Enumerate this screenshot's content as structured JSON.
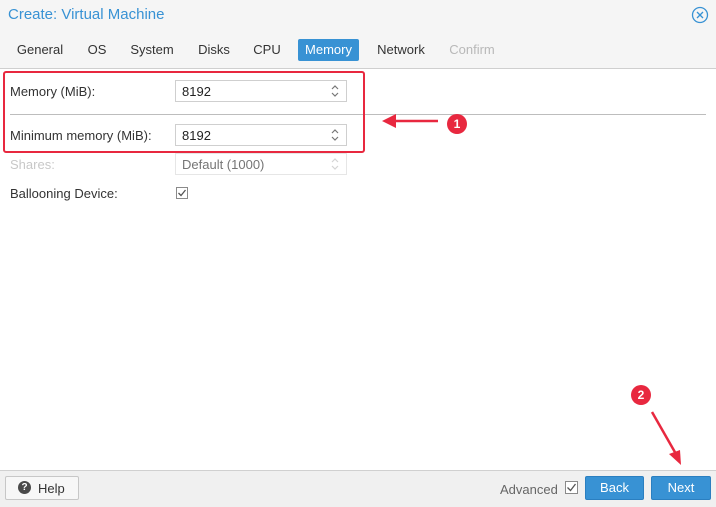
{
  "window": {
    "title": "Create: Virtual Machine",
    "close_icon": "close-circle-icon"
  },
  "tabs": [
    {
      "label": "General",
      "state": "normal"
    },
    {
      "label": "OS",
      "state": "normal"
    },
    {
      "label": "System",
      "state": "normal"
    },
    {
      "label": "Disks",
      "state": "normal"
    },
    {
      "label": "CPU",
      "state": "normal"
    },
    {
      "label": "Memory",
      "state": "active"
    },
    {
      "label": "Network",
      "state": "normal"
    },
    {
      "label": "Confirm",
      "state": "disabled"
    }
  ],
  "form": {
    "memory": {
      "label": "Memory (MiB):",
      "value": "8192"
    },
    "min_memory": {
      "label": "Minimum memory (MiB):",
      "value": "8192"
    },
    "shares": {
      "label": "Shares:",
      "placeholder": "Default (1000)",
      "disabled": true
    },
    "ballooning": {
      "label": "Ballooning Device:",
      "checked": true
    }
  },
  "annotations": {
    "badge_1": "1",
    "badge_2": "2",
    "color": "#e8283f"
  },
  "footer": {
    "help_label": "Help",
    "help_icon": "question-circle-icon",
    "advanced_label": "Advanced",
    "advanced_checked": true,
    "back_label": "Back",
    "next_label": "Next"
  },
  "colors": {
    "accent": "#3892d4",
    "annotation": "#e8283f"
  }
}
